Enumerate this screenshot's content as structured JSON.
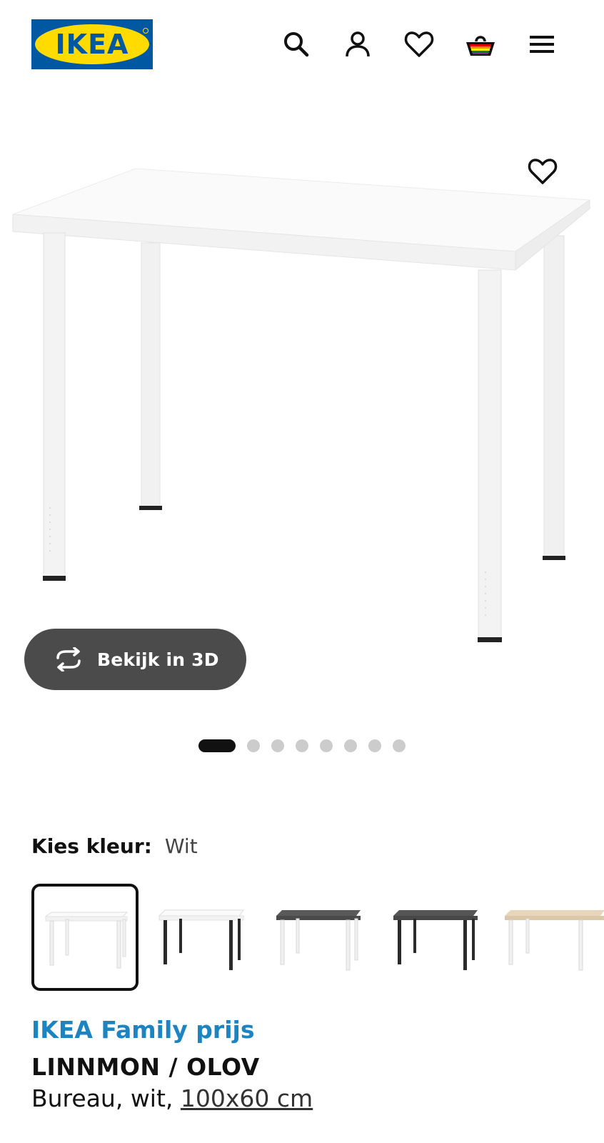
{
  "brand": {
    "logo_text": "IKEA",
    "colors": {
      "blue": "#0058A3",
      "yellow": "#FFDB00"
    }
  },
  "header": {
    "icons": [
      "search-icon",
      "user-icon",
      "heart-icon",
      "shopping-basket-icon",
      "menu-icon"
    ]
  },
  "gallery": {
    "view_3d_label": "Bekijk in 3D",
    "dots_total": 8,
    "active_dot": 1
  },
  "color_select": {
    "label": "Kies kleur:",
    "value": "Wit",
    "swatches": [
      {
        "top": "white",
        "legs": "white",
        "selected": true
      },
      {
        "top": "white",
        "legs": "black",
        "selected": false
      },
      {
        "top": "dark-grey",
        "legs": "white",
        "selected": false
      },
      {
        "top": "dark-grey",
        "legs": "black",
        "selected": false
      },
      {
        "top": "oak-effect",
        "legs": "white",
        "selected": false
      }
    ]
  },
  "product": {
    "family_price_label": "IKEA Family prijs",
    "name": "LINNMON / OLOV",
    "description_prefix": "Bureau, wit, ",
    "size": "100x60 cm"
  },
  "colors": {
    "family_blue": "#1d84c2",
    "button_dark": "#4b4b4b"
  }
}
